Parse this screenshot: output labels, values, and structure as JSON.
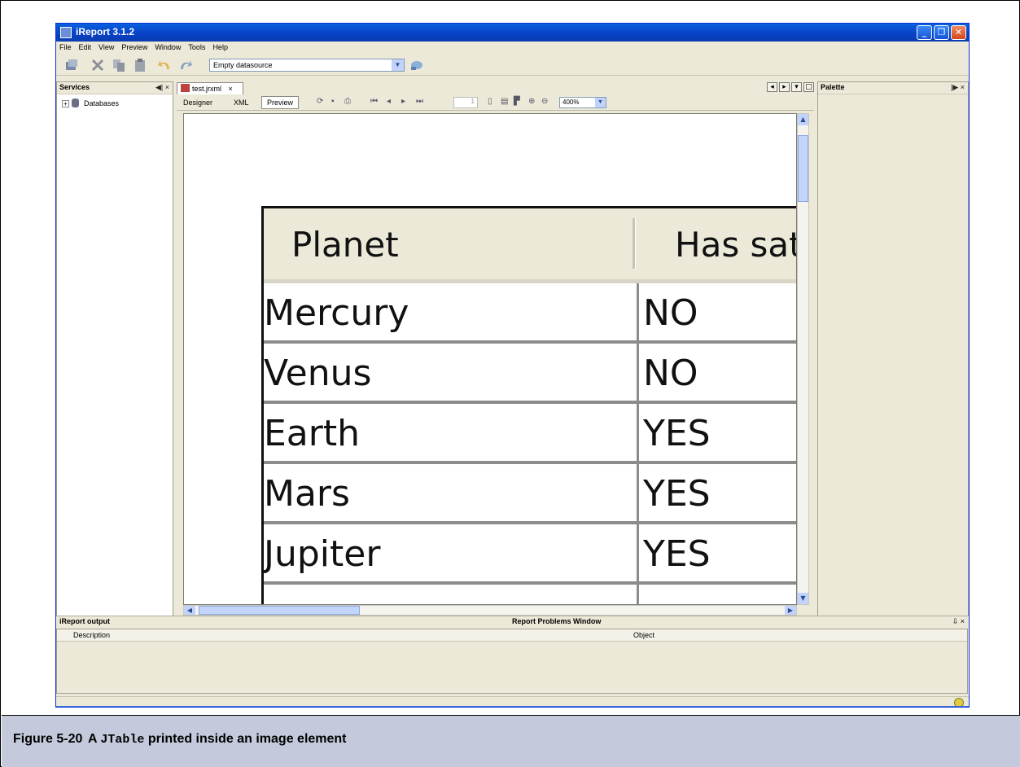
{
  "window": {
    "title": "iReport 3.1.2",
    "controls": [
      "_",
      "❐",
      "✕"
    ]
  },
  "menu": [
    "File",
    "Edit",
    "View",
    "Preview",
    "Window",
    "Tools",
    "Help"
  ],
  "toolbar": {
    "datasource": "Empty datasource",
    "icons": [
      "new-icon",
      "cut-icon",
      "copy-icon",
      "paste-icon",
      "undo-icon",
      "redo-icon",
      "datasource-icon"
    ]
  },
  "services": {
    "title": "Services",
    "controls": "◀| ×",
    "items": [
      {
        "label": "Databases"
      }
    ]
  },
  "editor": {
    "tab": "test.jrxml",
    "tab_close": "×",
    "views": [
      "Designer",
      "XML",
      "Preview"
    ],
    "page_number": "1",
    "zoom": "400%"
  },
  "table": {
    "headers": [
      "Planet",
      "Has sat"
    ],
    "rows": [
      [
        "Mercury",
        "NO"
      ],
      [
        "Venus",
        "NO"
      ],
      [
        "Earth",
        "YES"
      ],
      [
        "Mars",
        "YES"
      ],
      [
        "Jupiter",
        "YES"
      ]
    ]
  },
  "palette": {
    "title": "Palette",
    "controls": "|▶ ×"
  },
  "bottom": {
    "output_title": "iReport output",
    "problems_title": "Report Problems Window",
    "controls": "⇩ ×",
    "columns": [
      "Description",
      "Object"
    ]
  },
  "caption": {
    "figure": "Figure 5-20",
    "prefix": "A",
    "code": "JTable",
    "suffix": "printed inside an image element"
  }
}
